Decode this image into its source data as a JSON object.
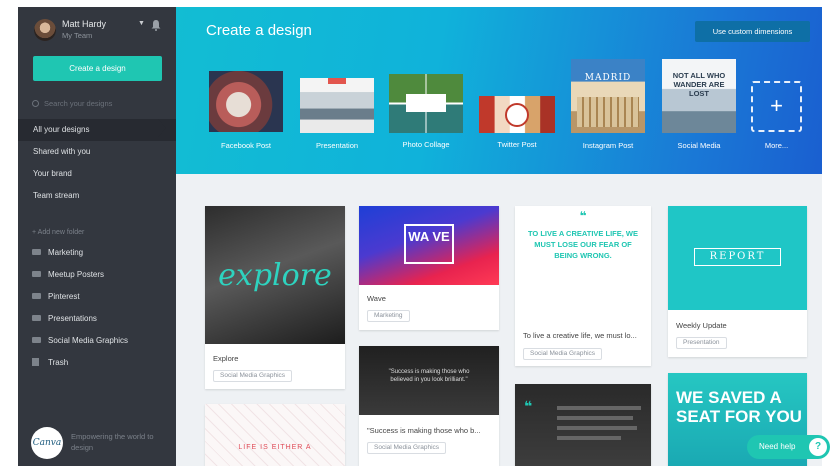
{
  "user": {
    "name": "Matt Hardy",
    "team": "My Team"
  },
  "sidebar": {
    "create_button": "Create a design",
    "search_placeholder": "Search your designs",
    "nav": [
      {
        "label": "All your designs",
        "active": true
      },
      {
        "label": "Shared with you"
      },
      {
        "label": "Your brand"
      },
      {
        "label": "Team stream"
      }
    ],
    "add_folder": "+ Add new folder",
    "folders": [
      "Marketing",
      "Meetup Posters",
      "Pinterest",
      "Presentations",
      "Social Media Graphics"
    ],
    "trash": "Trash",
    "logo_text": "Canva",
    "tagline": "Empowering the world to design"
  },
  "header": {
    "title": "Create a design",
    "custom_dimensions": "Use custom dimensions",
    "templates": [
      {
        "label": "Facebook Post",
        "thumb_text": ""
      },
      {
        "label": "Presentation",
        "thumb_text": ""
      },
      {
        "label": "Photo Collage",
        "thumb_text": ""
      },
      {
        "label": "Twitter Post",
        "thumb_text": ""
      },
      {
        "label": "Instagram Post",
        "thumb_text": "MADRID"
      },
      {
        "label": "Social Media",
        "thumb_text": "NOT ALL WHO WANDER ARE LOST"
      },
      {
        "label": "More...",
        "thumb_text": "+"
      }
    ]
  },
  "designs": [
    {
      "title": "Explore",
      "tag": "Social Media Graphics",
      "image_text": "explore"
    },
    {
      "title": "Wave",
      "tag": "Marketing",
      "image_text": "WA VE"
    },
    {
      "title": "To live a creative life, we must lo...",
      "tag": "Social Media Graphics",
      "image_text": "TO LIVE A CREATIVE LIFE, WE MUST LOSE OUR FEAR OF BEING WRONG."
    },
    {
      "title": "Weekly Update",
      "tag": "Presentation",
      "image_text": "REPORT"
    },
    {
      "title": "\"Success is making those who b...",
      "tag": "Social Media Graphics",
      "image_text": "\"Success is making those who believed in you look brilliant.\""
    },
    {
      "title": "",
      "tag": "",
      "image_text": "LIFE IS EITHER A"
    },
    {
      "title": "",
      "tag": "",
      "image_text": ""
    },
    {
      "title": "",
      "tag": "",
      "image_text": "WE SAVED A SEAT FOR YOU"
    }
  ],
  "help": {
    "label": "Need help",
    "icon": "?"
  }
}
